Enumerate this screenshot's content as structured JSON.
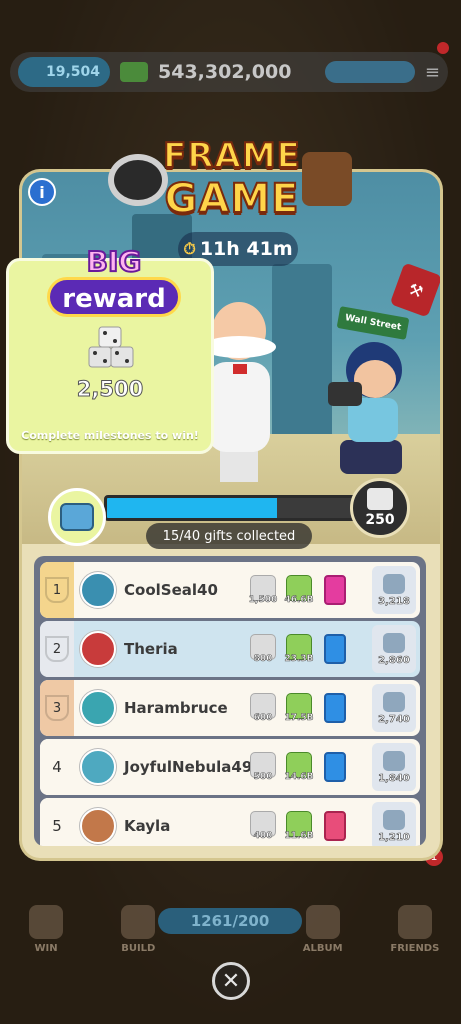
{
  "topbar": {
    "dice_count": "19,504",
    "cash": "543,302,000"
  },
  "event": {
    "title_line1": "FRAME",
    "title_line2": "GAME",
    "timer": "11h 41m",
    "info_label": "i"
  },
  "scene": {
    "street_sign": "Wall Street"
  },
  "big_reward": {
    "logo_top": "BIG",
    "logo_bottom": "reward",
    "amount": "2,500",
    "note": "Complete milestones to win!"
  },
  "progress": {
    "next_reward_value": "250",
    "label": "15/40 gifts collected",
    "fraction": 0.66
  },
  "leaderboard": [
    {
      "rank": "1",
      "name": "CoolSeal40",
      "dice": "1,500",
      "cash": "46.6B",
      "sticker": "pink",
      "points": "3,218",
      "highlight": false
    },
    {
      "rank": "2",
      "name": "Theria",
      "dice": "800",
      "cash": "23.3B",
      "sticker": "blue",
      "points": "2,860",
      "highlight": true
    },
    {
      "rank": "3",
      "name": "Harambruce",
      "dice": "600",
      "cash": "17.5B",
      "sticker": "blue",
      "points": "2,740",
      "highlight": false
    },
    {
      "rank": "4",
      "name": "JoyfulNebula49",
      "dice": "500",
      "cash": "14.6B",
      "sticker": "blue",
      "points": "1,840",
      "highlight": false
    },
    {
      "rank": "5",
      "name": "Kayla",
      "dice": "400",
      "cash": "11.6B",
      "sticker": "pink",
      "points": "1,210",
      "highlight": false
    }
  ],
  "bottom": {
    "progress_pill": "1261/200",
    "nav": [
      "WIN",
      "BUILD",
      "",
      "ALBUM",
      "FRIENDS"
    ],
    "friends_badge": "1"
  },
  "colors": {
    "panel": "#e9dfb8",
    "progress_fill": "#1fb6f0",
    "reward_card": "#eaf5a1",
    "highlight_row": "#cfe4ef"
  }
}
